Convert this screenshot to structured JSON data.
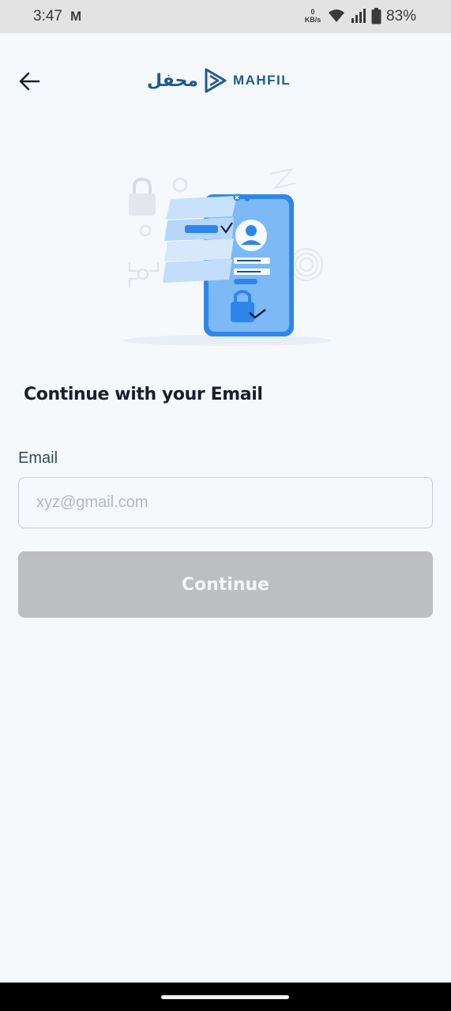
{
  "status_bar": {
    "time": "3:47",
    "notification_icon": "gmail-icon",
    "speed_value": "0",
    "speed_unit": "KB/s",
    "battery": "83%"
  },
  "header": {
    "logo_arabic": "محفل",
    "logo_text": "MAHFIL",
    "brand_color": "#1f5a8c"
  },
  "main": {
    "heading": "Continue with your Email",
    "email_label": "Email",
    "email_placeholder": "xyz@gmail.com",
    "email_value": "",
    "continue_label": "Continue"
  },
  "colors": {
    "background": "#f5f9fc",
    "button_disabled": "#bcbec2",
    "illustration_blue": "#4a9ef0"
  }
}
